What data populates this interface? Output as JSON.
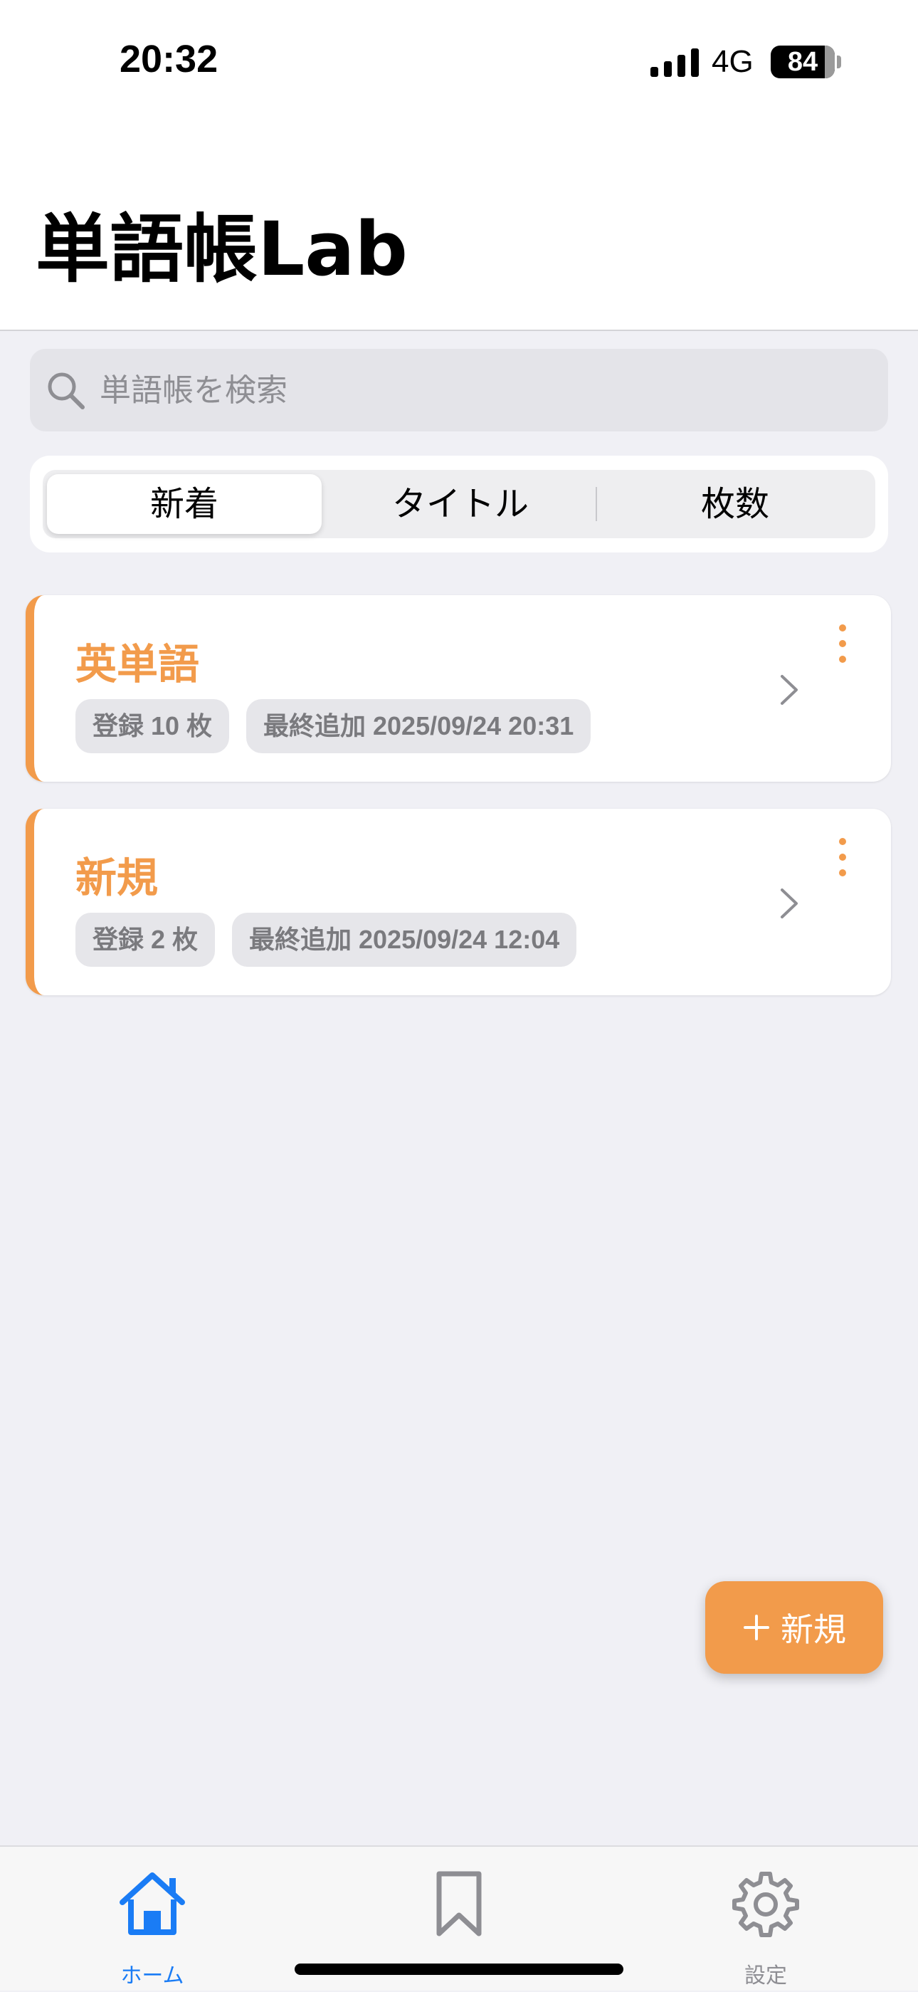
{
  "status_bar": {
    "time": "20:32",
    "network": "4G",
    "battery": "84"
  },
  "header": {
    "title": "単語帳Lab"
  },
  "search": {
    "placeholder": "単語帳を検索",
    "value": "",
    "icon": "search-icon"
  },
  "sort": {
    "options": [
      "新着",
      "タイトル",
      "枚数"
    ],
    "selected": "新着"
  },
  "decks": [
    {
      "title": "英単語",
      "count_label": "登録 10 枚",
      "last_added_label": "最終追加 2025/09/24 20:31"
    },
    {
      "title": "新規",
      "count_label": "登録 2 枚",
      "last_added_label": "最終追加 2025/09/24 12:04"
    }
  ],
  "fab": {
    "label": "新規",
    "icon": "plus-icon"
  },
  "tabbar": {
    "items": [
      {
        "label": "ホーム",
        "icon": "home-icon",
        "active": true
      },
      {
        "label": "",
        "icon": "bookmark-icon",
        "active": false
      },
      {
        "label": "設定",
        "icon": "gear-icon",
        "active": false
      }
    ]
  },
  "colors": {
    "accent": "#f29b4b",
    "tab_active": "#1a7cf5",
    "background": "#f0f0f5"
  }
}
